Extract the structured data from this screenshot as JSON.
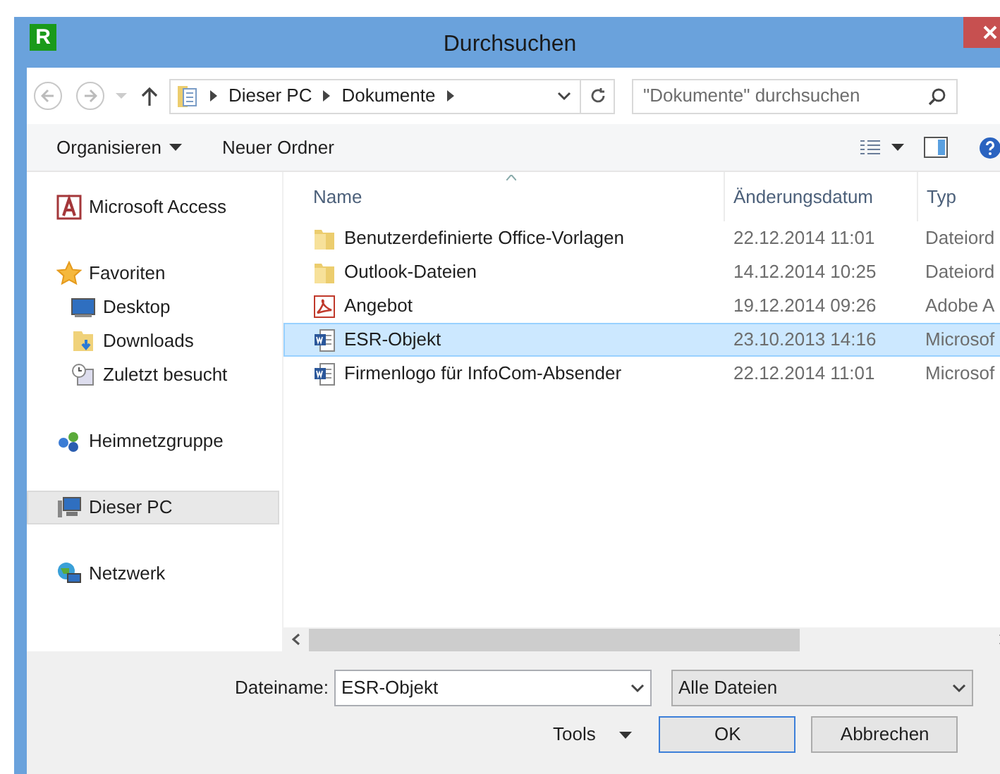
{
  "window": {
    "title": "Durchsuchen",
    "app_letter": "R"
  },
  "address": {
    "crumbs": [
      "Dieser PC",
      "Dokumente"
    ],
    "search_placeholder": "\"Dokumente\" durchsuchen"
  },
  "toolbar": {
    "buttons": [
      {
        "label": "Organisieren",
        "dropdown": true
      },
      {
        "label": "Neuer Ordner",
        "dropdown": false
      }
    ]
  },
  "sidebar": {
    "groups": [
      {
        "label": "Microsoft Access",
        "kind": "access",
        "selected": false
      },
      {
        "label": "Favoriten",
        "kind": "star",
        "selected": false,
        "children": [
          {
            "label": "Desktop",
            "kind": "desktop",
            "selected": false
          },
          {
            "label": "Downloads",
            "kind": "downloads",
            "selected": false
          },
          {
            "label": "Zuletzt besucht",
            "kind": "recent",
            "selected": false
          }
        ]
      },
      {
        "label": "Heimnetzgruppe",
        "kind": "homegroup",
        "selected": false
      },
      {
        "label": "Dieser PC",
        "kind": "pc",
        "selected": true
      },
      {
        "label": "Netzwerk",
        "kind": "network",
        "selected": false
      }
    ]
  },
  "table": {
    "columns": [
      "Name",
      "Änderungsdatum",
      "Typ"
    ],
    "rows": [
      {
        "kind": "folder",
        "name": "Benutzerdefinierte Office-Vorlagen",
        "date": "22.12.2014 11:01",
        "type": "Dateiord",
        "selected": false
      },
      {
        "kind": "folder",
        "name": "Outlook-Dateien",
        "date": "14.12.2014 10:25",
        "type": "Dateiord",
        "selected": false
      },
      {
        "kind": "pdf",
        "name": "Angebot",
        "date": "19.12.2014 09:26",
        "type": "Adobe A",
        "selected": false
      },
      {
        "kind": "word",
        "name": "ESR-Objekt",
        "date": "23.10.2013 14:16",
        "type": "Microsof",
        "selected": true
      },
      {
        "kind": "word",
        "name": "Firmenlogo für InfoCom-Absender",
        "date": "22.12.2014 11:01",
        "type": "Microsof",
        "selected": false
      }
    ]
  },
  "footer": {
    "filename_label": "Dateiname:",
    "filename_value": "ESR-Objekt",
    "filter": "Alle Dateien",
    "tools": "Tools",
    "ok": "OK",
    "cancel": "Abbrechen"
  }
}
